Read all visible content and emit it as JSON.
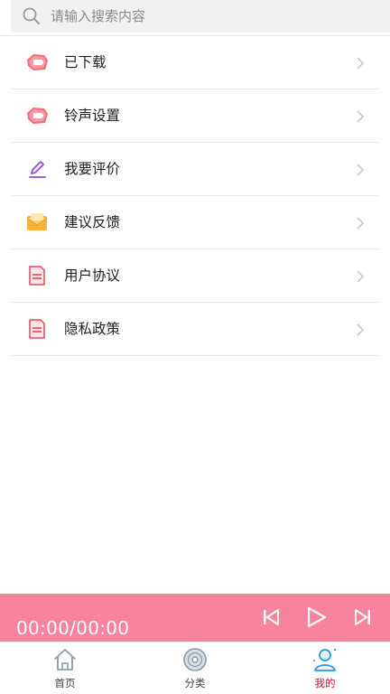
{
  "search": {
    "placeholder": "请输入搜索内容",
    "value": ""
  },
  "menu": [
    {
      "label": "已下载",
      "icon": "download-icon"
    },
    {
      "label": "铃声设置",
      "icon": "ringtone-icon"
    },
    {
      "label": "我要评价",
      "icon": "pencil-icon"
    },
    {
      "label": "建议反馈",
      "icon": "mail-icon"
    },
    {
      "label": "用户协议",
      "icon": "document-icon"
    },
    {
      "label": "隐私政策",
      "icon": "document-icon"
    }
  ],
  "player": {
    "time": "00:00/00:00"
  },
  "tabs": [
    {
      "label": "首页",
      "icon": "home-icon",
      "active": false
    },
    {
      "label": "分类",
      "icon": "disc-icon",
      "active": false
    },
    {
      "label": "我的",
      "icon": "user-icon",
      "active": true
    }
  ],
  "colors": {
    "accent": "#f7849c",
    "active_tab": "#c8102e"
  }
}
